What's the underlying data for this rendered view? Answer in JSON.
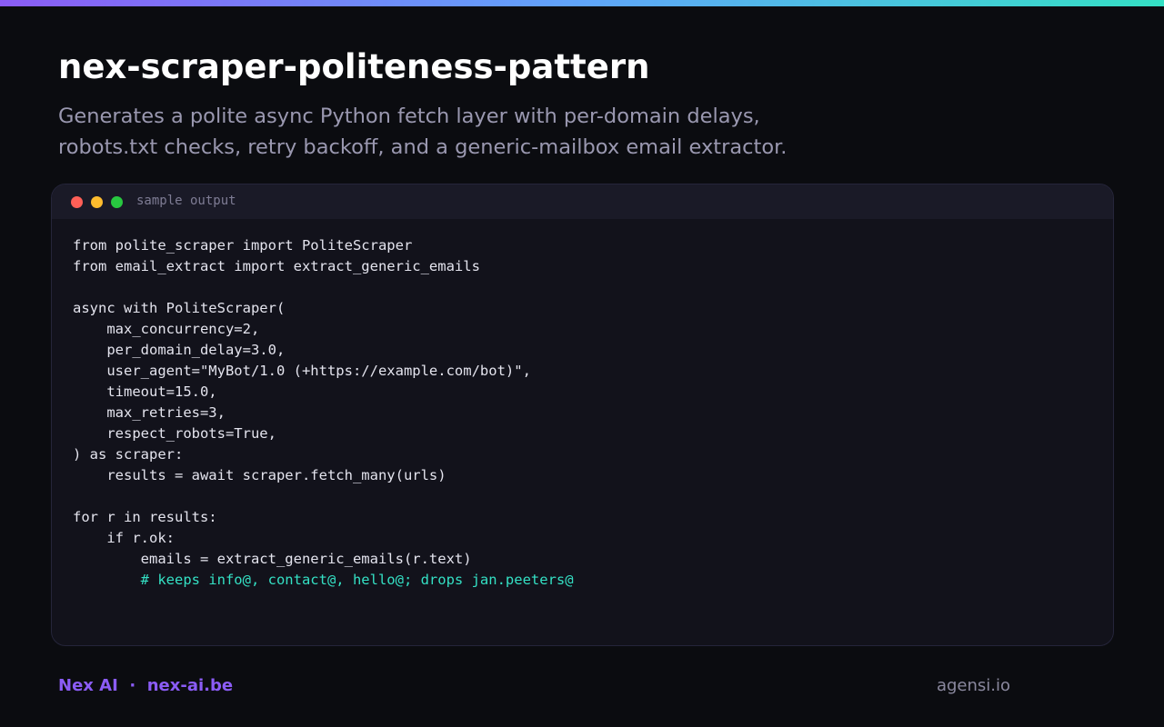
{
  "theme": {
    "accent": "#8b5cf6",
    "gradient_start": "#8b5cf6",
    "gradient_mid": "#60a5fa",
    "gradient_end": "#34e0c4",
    "background": "#0b0c10",
    "comment_color": "#34e0c4"
  },
  "header": {
    "title": "nex-scraper-politeness-pattern",
    "subtitle_lines": [
      "Generates a polite async Python fetch layer with per-domain delays,",
      "robots.txt checks, retry backoff, and a generic-mailbox email extractor."
    ]
  },
  "code_window": {
    "label": "sample output",
    "lines": [
      "from polite_scraper import PoliteScraper",
      "from email_extract import extract_generic_emails",
      "",
      "async with PoliteScraper(",
      "    max_concurrency=2,",
      "    per_domain_delay=3.0,",
      "    user_agent=\"MyBot/1.0 (+https://example.com/bot)\",",
      "    timeout=15.0,",
      "    max_retries=3,",
      "    respect_robots=True,",
      ") as scraper:",
      "    results = await scraper.fetch_many(urls)",
      "",
      "for r in results:",
      "    if r.ok:",
      "        emails = extract_generic_emails(r.text)",
      "        # keeps info@, contact@, hello@; drops jan.peeters@"
    ]
  },
  "footer": {
    "brand": "Nex AI",
    "separator": "·",
    "site": "nex-ai.be",
    "right_text": "agensi.io"
  }
}
